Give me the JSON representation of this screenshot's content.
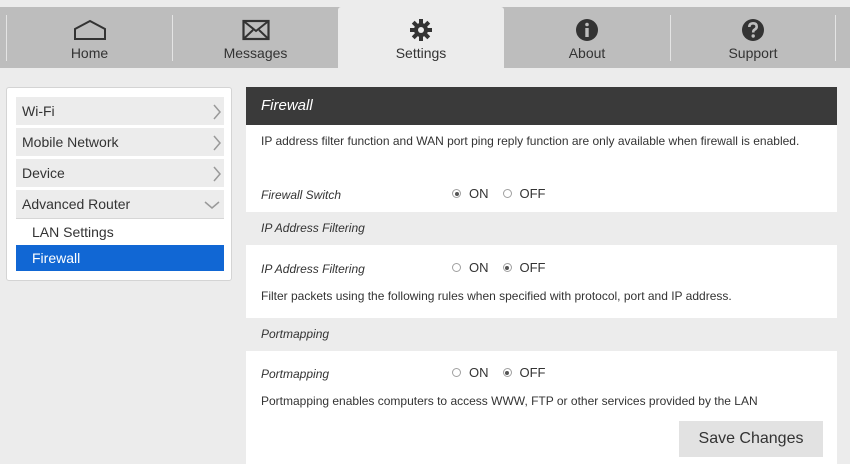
{
  "nav": {
    "tabs": [
      {
        "label": "Home",
        "icon": "home-icon"
      },
      {
        "label": "Messages",
        "icon": "envelope-icon"
      },
      {
        "label": "Settings",
        "icon": "gear-icon",
        "active": true
      },
      {
        "label": "About",
        "icon": "info-icon"
      },
      {
        "label": "Support",
        "icon": "question-icon"
      }
    ]
  },
  "sidebar": {
    "items": [
      {
        "label": "Wi-Fi"
      },
      {
        "label": "Mobile Network"
      },
      {
        "label": "Device"
      },
      {
        "label": "Advanced Router",
        "expanded": true
      }
    ],
    "subitems": [
      {
        "label": "LAN Settings"
      },
      {
        "label": "Firewall",
        "active": true
      }
    ]
  },
  "panel": {
    "title": "Firewall",
    "intro": "IP address filter function and WAN port ping reply function are only available when firewall is enabled.",
    "firewall_switch": {
      "label": "Firewall Switch",
      "on_label": "ON",
      "off_label": "OFF",
      "value": "ON"
    },
    "ip_filter_section": "IP Address Filtering",
    "ip_filter": {
      "label": "IP Address Filtering",
      "on_label": "ON",
      "off_label": "OFF",
      "value": "OFF"
    },
    "ip_filter_desc": "Filter packets using the following rules when specified with protocol, port and IP address.",
    "portmapping_section": "Portmapping",
    "portmapping": {
      "label": "Portmapping",
      "on_label": "ON",
      "off_label": "OFF",
      "value": "OFF"
    },
    "portmapping_desc": "Portmapping enables computers to access WWW, FTP or other services provided by the LAN",
    "save_label": "Save Changes"
  },
  "colors": {
    "topbar": "#bdbdbd",
    "active_blue": "#1167d4",
    "header_dark": "#3a3a3a"
  }
}
